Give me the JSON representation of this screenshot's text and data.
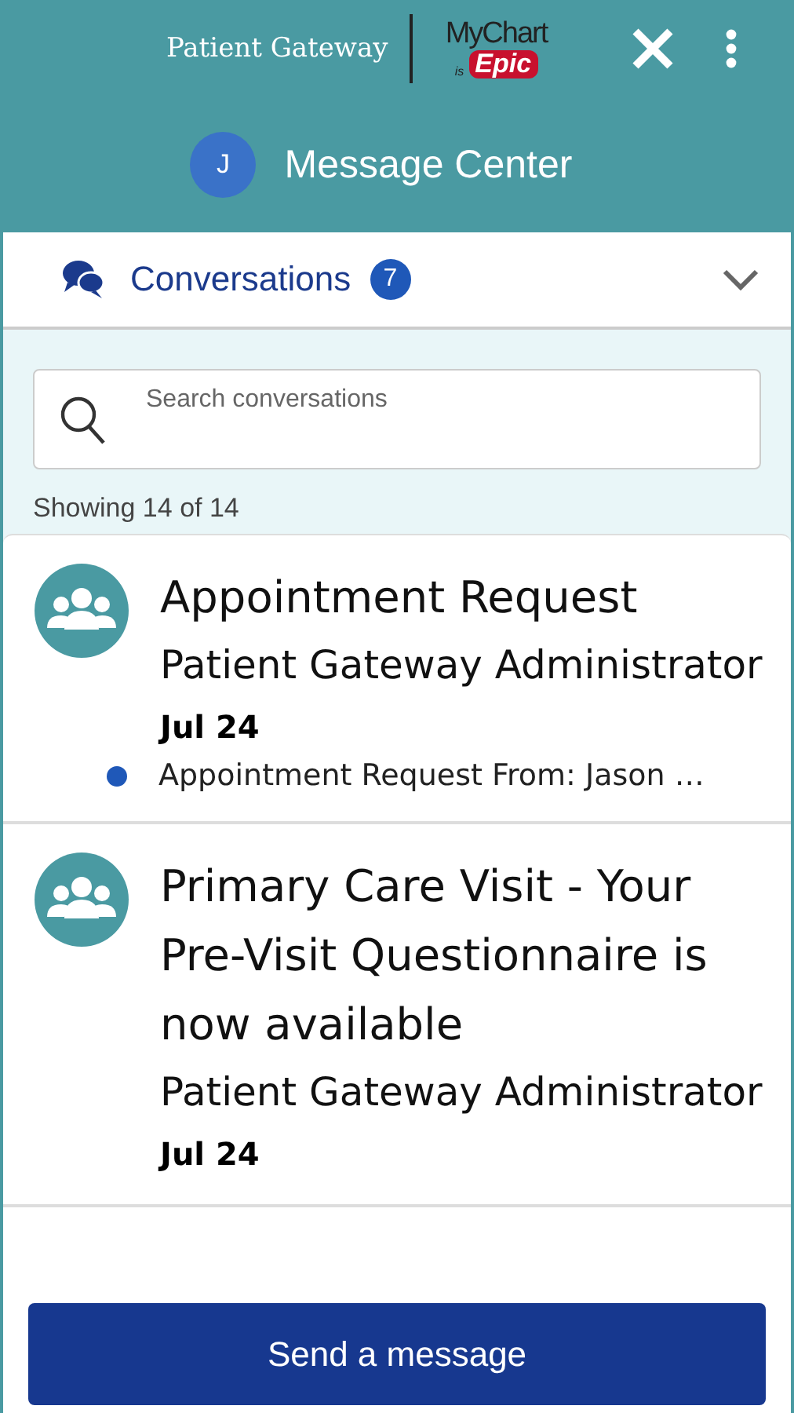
{
  "header": {
    "brand": "Patient Gateway",
    "logo": {
      "top": "MyChart",
      "small": "is",
      "bottom": "Epic"
    },
    "avatar_initial": "J",
    "title": "Message Center"
  },
  "section": {
    "label": "Conversations",
    "badge": "7",
    "expanded": true
  },
  "search": {
    "placeholder": "Search conversations"
  },
  "count_text": "Showing 14 of 14",
  "conversations": [
    {
      "subject": "Appointment Request",
      "sender": "Patient Gateway Administrator",
      "date": "Jul 24",
      "preview": "Appointment Request From: Jason …",
      "unread": true
    },
    {
      "subject": "Primary Care Visit - Your Pre-Visit Questionnaire is now available",
      "sender": "Patient Gateway Administrator",
      "date": "Jul 24"
    }
  ],
  "primary_button": "Send a message"
}
